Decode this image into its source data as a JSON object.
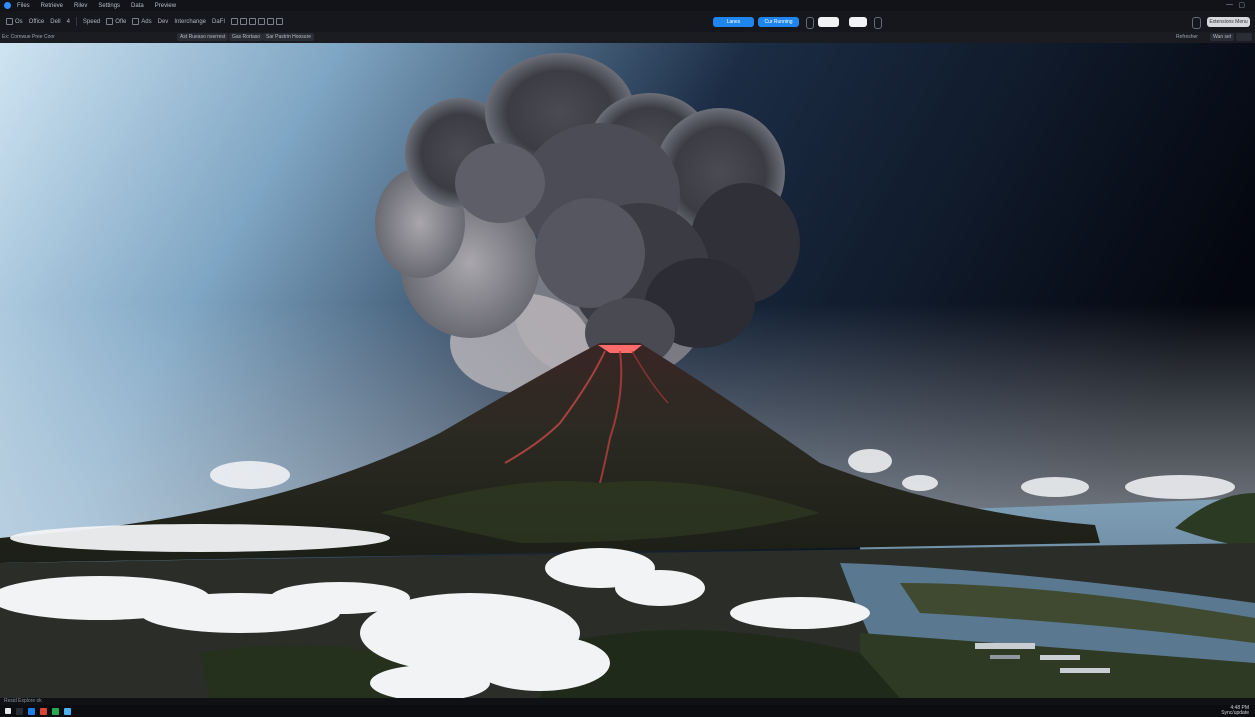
{
  "menu": [
    "Files",
    "Retrieve",
    "Rilev",
    "Settings",
    "Data",
    "Preview"
  ],
  "window_controls": [
    "—",
    "▢"
  ],
  "toolbar": {
    "buttons": [
      "Os",
      "Office",
      "Dell",
      "4",
      "Speed",
      "Ofle",
      "Ads",
      "Dev",
      "Interchange",
      "DaFI"
    ]
  },
  "actions": {
    "primary": "Lanes",
    "secondary": "Cur Running",
    "box1": "",
    "box2": "",
    "right": "Extensions Menu"
  },
  "subbar": {
    "path": "Ex: Cornwue Pree Coor",
    "chips": [
      "Ast Rueaso nserrest",
      "Gas Rortaso",
      "Sar Pastrin Hoosure"
    ],
    "right_label": "Refresher",
    "right_chip": "Wan set"
  },
  "status": {
    "text": "Resid   Explore  ok"
  },
  "taskbar": {
    "icon_colors": [
      "#1b7fe3",
      "#d9473a",
      "#27a853",
      "#4ab3f0"
    ],
    "clock_time": "4:48 PM",
    "clock_date": "Sync/update"
  }
}
